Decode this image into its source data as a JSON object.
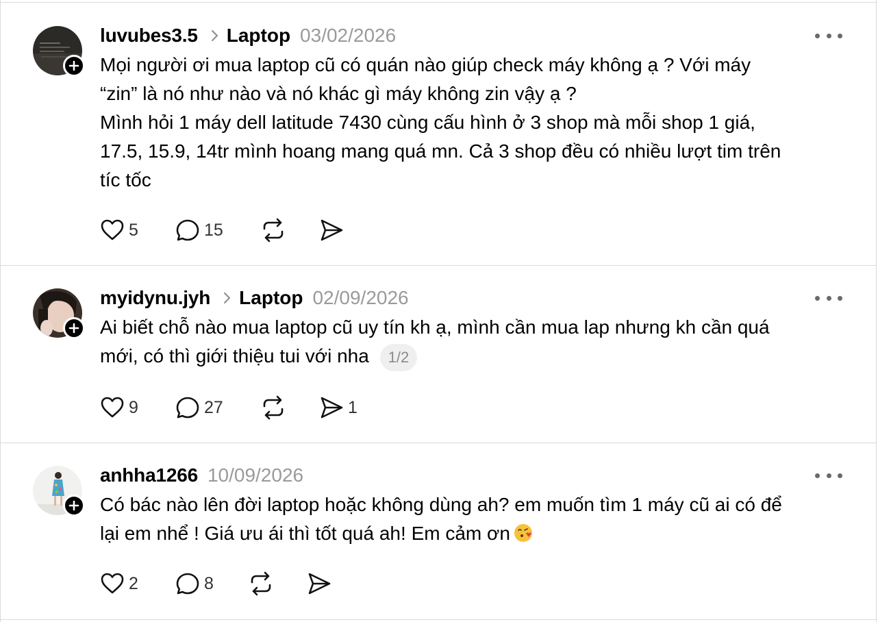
{
  "posts": [
    {
      "username": "luvubes3.5",
      "topic": "Laptop",
      "date": "03/02/2026",
      "text": "Mọi người ơi mua laptop cũ có quán nào giúp check máy không ạ ? Với máy\n“zin” là nó như nào và nó khác gì máy không zin vậy ạ ?\nMình hỏi 1 máy dell latitude 7430 cùng cấu hình ở 3 shop mà mỗi shop 1 giá,\n17.5, 15.9, 14tr mình hoang mang quá mn. Cả 3 shop đều có nhiều lượt tim trên\ntíc tốc",
      "likes": "5",
      "comments": "15",
      "shares": ""
    },
    {
      "username": "myidynu.jyh",
      "topic": "Laptop",
      "date": "02/09/2026",
      "text": "Ai biết chỗ nào mua laptop cũ uy tín kh ạ, mình cần mua lap nhưng kh cần quá\nmới, có thì giới thiệu tui với nha",
      "pager": "1/2",
      "likes": "9",
      "comments": "27",
      "shares": "1"
    },
    {
      "username": "anhha1266",
      "topic": "",
      "date": "10/09/2026",
      "text": "Có bác nào lên đời laptop hoặc không dùng ah? em muốn tìm 1 máy cũ ai có để\nlại em nhể ! Giá ưu ái thì tốt quá ah! Em cảm ơn",
      "emoji": "face-blowing-kiss",
      "likes": "2",
      "comments": "8",
      "shares": ""
    }
  ]
}
